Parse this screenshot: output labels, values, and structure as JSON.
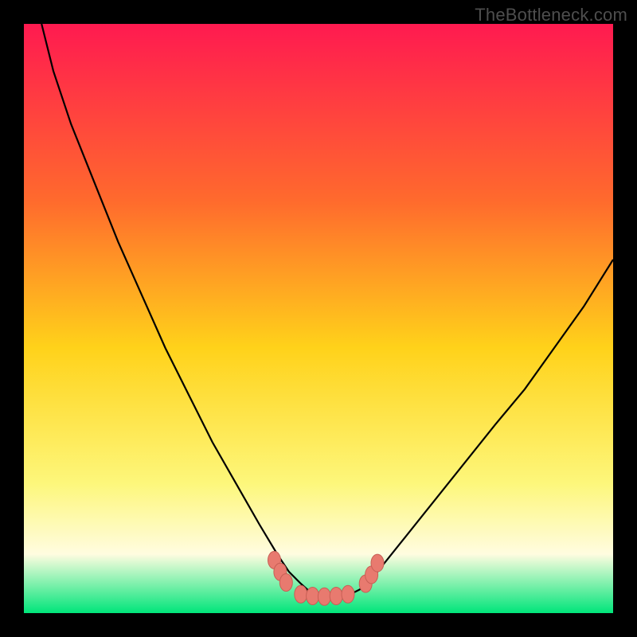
{
  "watermark": "TheBottleneck.com",
  "colors": {
    "black": "#000000",
    "gradient_top": "#ff1a50",
    "gradient_mid_upper": "#ff6a2d",
    "gradient_mid": "#ffd21a",
    "gradient_lower": "#fdf77b",
    "gradient_pale": "#fffce0",
    "gradient_bottom": "#00e57a",
    "curve": "#000000",
    "marker_fill": "#e87a6f",
    "marker_stroke": "#c85f55"
  },
  "chart_data": {
    "type": "line",
    "title": "",
    "xlabel": "",
    "ylabel": "",
    "xlim": [
      0,
      100
    ],
    "ylim": [
      0,
      100
    ],
    "x": [
      3,
      5,
      8,
      12,
      16,
      20,
      24,
      28,
      32,
      36,
      40,
      43,
      45,
      47,
      49,
      51,
      53,
      55,
      57,
      60,
      64,
      68,
      72,
      76,
      80,
      85,
      90,
      95,
      100
    ],
    "values": [
      100,
      92,
      83,
      73,
      63,
      54,
      45,
      37,
      29,
      22,
      15,
      10,
      7,
      5,
      3.2,
      2.8,
      2.8,
      3,
      4,
      7,
      12,
      17,
      22,
      27,
      32,
      38,
      45,
      52,
      60
    ],
    "markers": [
      {
        "x": 42.5,
        "y": 9
      },
      {
        "x": 43.5,
        "y": 7
      },
      {
        "x": 44.5,
        "y": 5.2
      },
      {
        "x": 47,
        "y": 3.2
      },
      {
        "x": 49,
        "y": 2.9
      },
      {
        "x": 51,
        "y": 2.8
      },
      {
        "x": 53,
        "y": 2.9
      },
      {
        "x": 55,
        "y": 3.2
      },
      {
        "x": 58,
        "y": 5
      },
      {
        "x": 59,
        "y": 6.5
      },
      {
        "x": 60,
        "y": 8.5
      }
    ]
  }
}
